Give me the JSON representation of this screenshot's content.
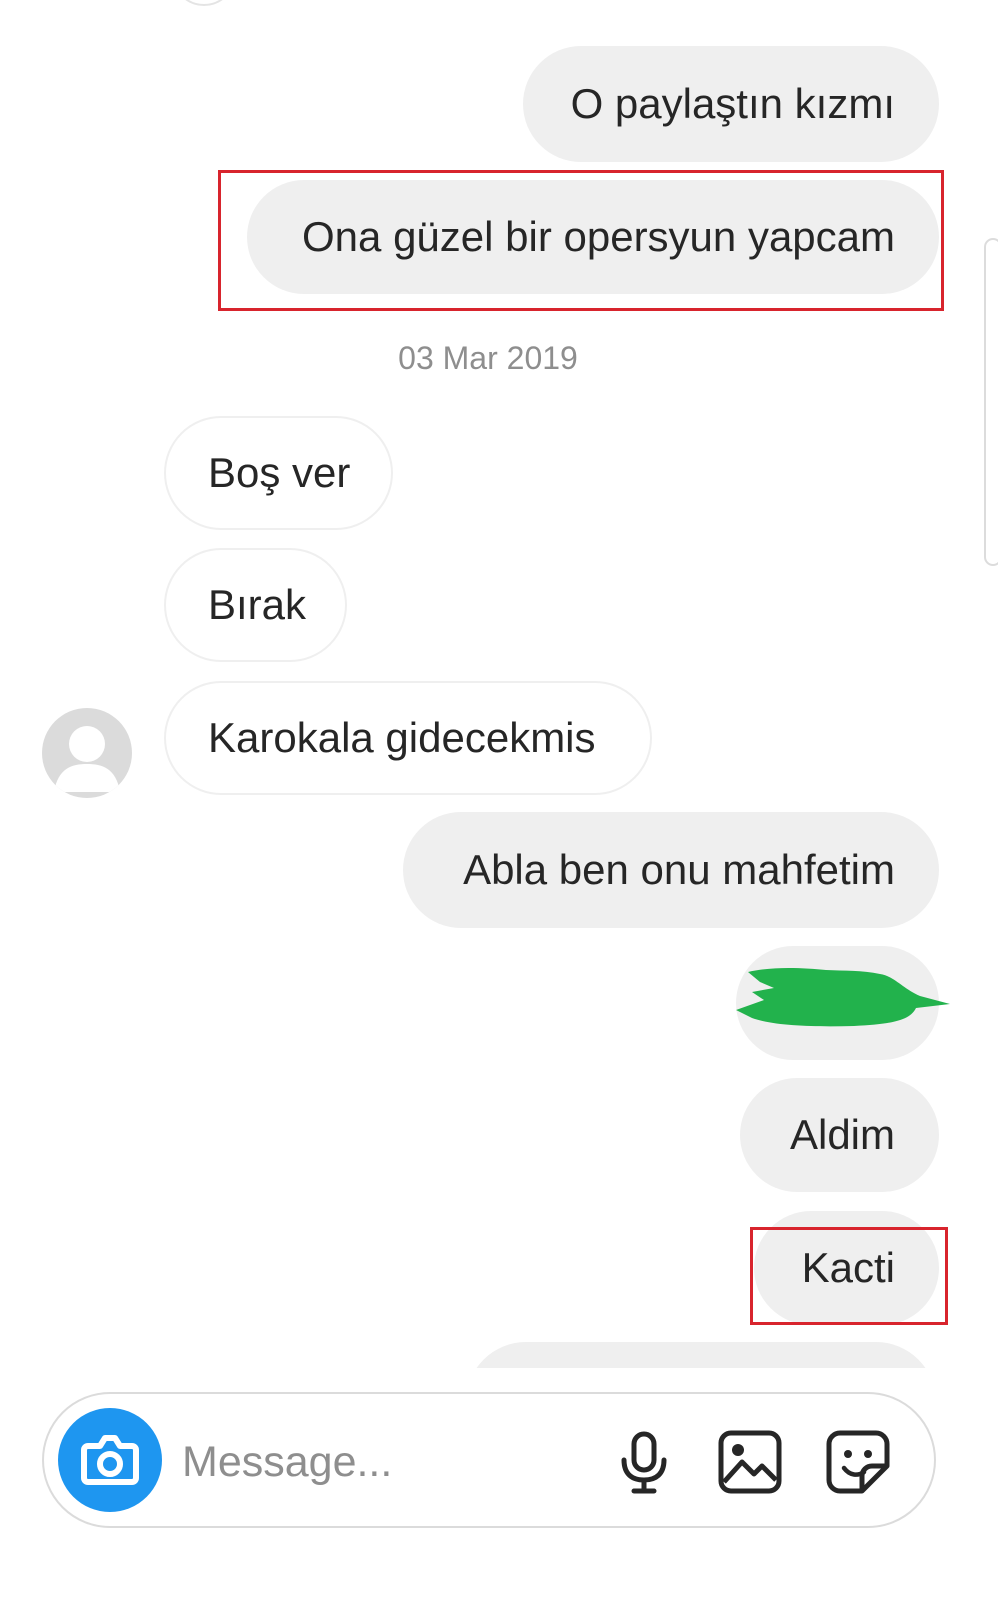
{
  "messages": [
    {
      "direction": "out",
      "text": "O paylaştın kızmı"
    },
    {
      "direction": "out",
      "text": "Ona güzel bir opersyun yapcam",
      "highlighted": true
    },
    {
      "type": "date",
      "text": "03 Mar 2019"
    },
    {
      "direction": "in",
      "text": "Boş ver"
    },
    {
      "direction": "in",
      "text": "Bırak"
    },
    {
      "direction": "in",
      "text": "Karokala gidecekmis"
    },
    {
      "direction": "out",
      "text": "Abla ben onu mahfetim"
    },
    {
      "direction": "out",
      "text": "",
      "redacted": true,
      "redaction_color": "#22b24c"
    },
    {
      "direction": "out",
      "text": "Aldim"
    },
    {
      "direction": "out",
      "text": "Kacti",
      "highlighted": true
    }
  ],
  "composer": {
    "placeholder": "Message...",
    "camera_icon": "camera-icon",
    "mic_icon": "microphone-icon",
    "gallery_icon": "image-gallery-icon",
    "sticker_icon": "sticker-icon"
  },
  "colors": {
    "outgoing_bubble": "#efefef",
    "incoming_border": "#efefef",
    "text": "#262626",
    "muted": "#8e8e8e",
    "highlight_box": "#d8242d",
    "camera_button": "#1e96f0"
  }
}
